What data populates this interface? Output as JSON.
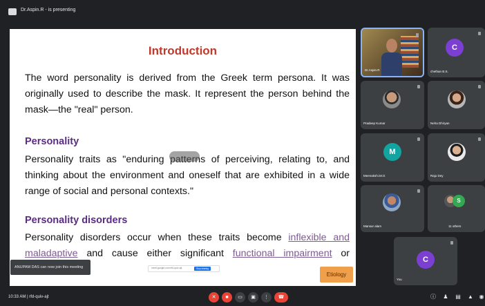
{
  "header": {
    "presenting_text": "Dr.Aspin.R - is presenting"
  },
  "slide": {
    "title": "Introduction",
    "intro_paragraph": "The word personality is derived from the Greek term persona. It was originally used to describe the mask. It represent the person behind the mask—the \"real\" person.",
    "section1_heading": "Personality",
    "section1_paragraph": "Personality traits as \"enduring patterns of perceiving, relating to, and thinking about the environment and oneself that are exhibited in a wide range of social and personal contexts.\"",
    "section2_heading": "Personality disorders",
    "section2_part1": "Personality disorders occur when these traits become ",
    "section2_link1": "inflexible and maladaptive",
    "section2_part2": " and cause either significant ",
    "section2_link2": "functional impairment",
    "section2_part3": " or subjective",
    "etiology_button": "Etiology"
  },
  "toast": {
    "text": "ANUPAM DAS can now join this meeting"
  },
  "mid_strip": {
    "text": "meet.google.com/rfd-quiv-ajt",
    "button": "Stop sharing"
  },
  "participants": [
    {
      "name": "Dr.Aspin.R",
      "type": "video"
    },
    {
      "name": "chethan B.S.",
      "initial": "C",
      "color": "#7b3fd1"
    },
    {
      "name": "Pradeep Kumar",
      "type": "photo"
    },
    {
      "name": "Neha Dhiryan",
      "type": "photo"
    },
    {
      "name": "Meenakshi.M.G",
      "initial": "M",
      "color": "#12a4a0"
    },
    {
      "name": "Raju Dey",
      "type": "photo"
    },
    {
      "name": "Mansur alam",
      "type": "photo"
    },
    {
      "name": "11 others"
    },
    {
      "name": "You",
      "initial": "C",
      "color": "#7b3fd1"
    }
  ],
  "footer": {
    "time_code": "10:33 AM | rfd-quiv-ajt"
  },
  "icons": {
    "mic": "mic-off-icon",
    "camera": "camera-off-icon",
    "captions": "captions-icon",
    "present": "present-icon",
    "more": "more-options-icon",
    "leave": "leave-call-icon",
    "info": "info-icon",
    "people": "people-icon",
    "chat": "chat-icon",
    "activities": "activities-icon"
  },
  "colors": {
    "title_red": "#c0392b",
    "heading_purple": "#5b2c83",
    "etiology_orange": "#f0a04b",
    "meet_red": "#ea4335",
    "meet_dark": "#202124"
  }
}
